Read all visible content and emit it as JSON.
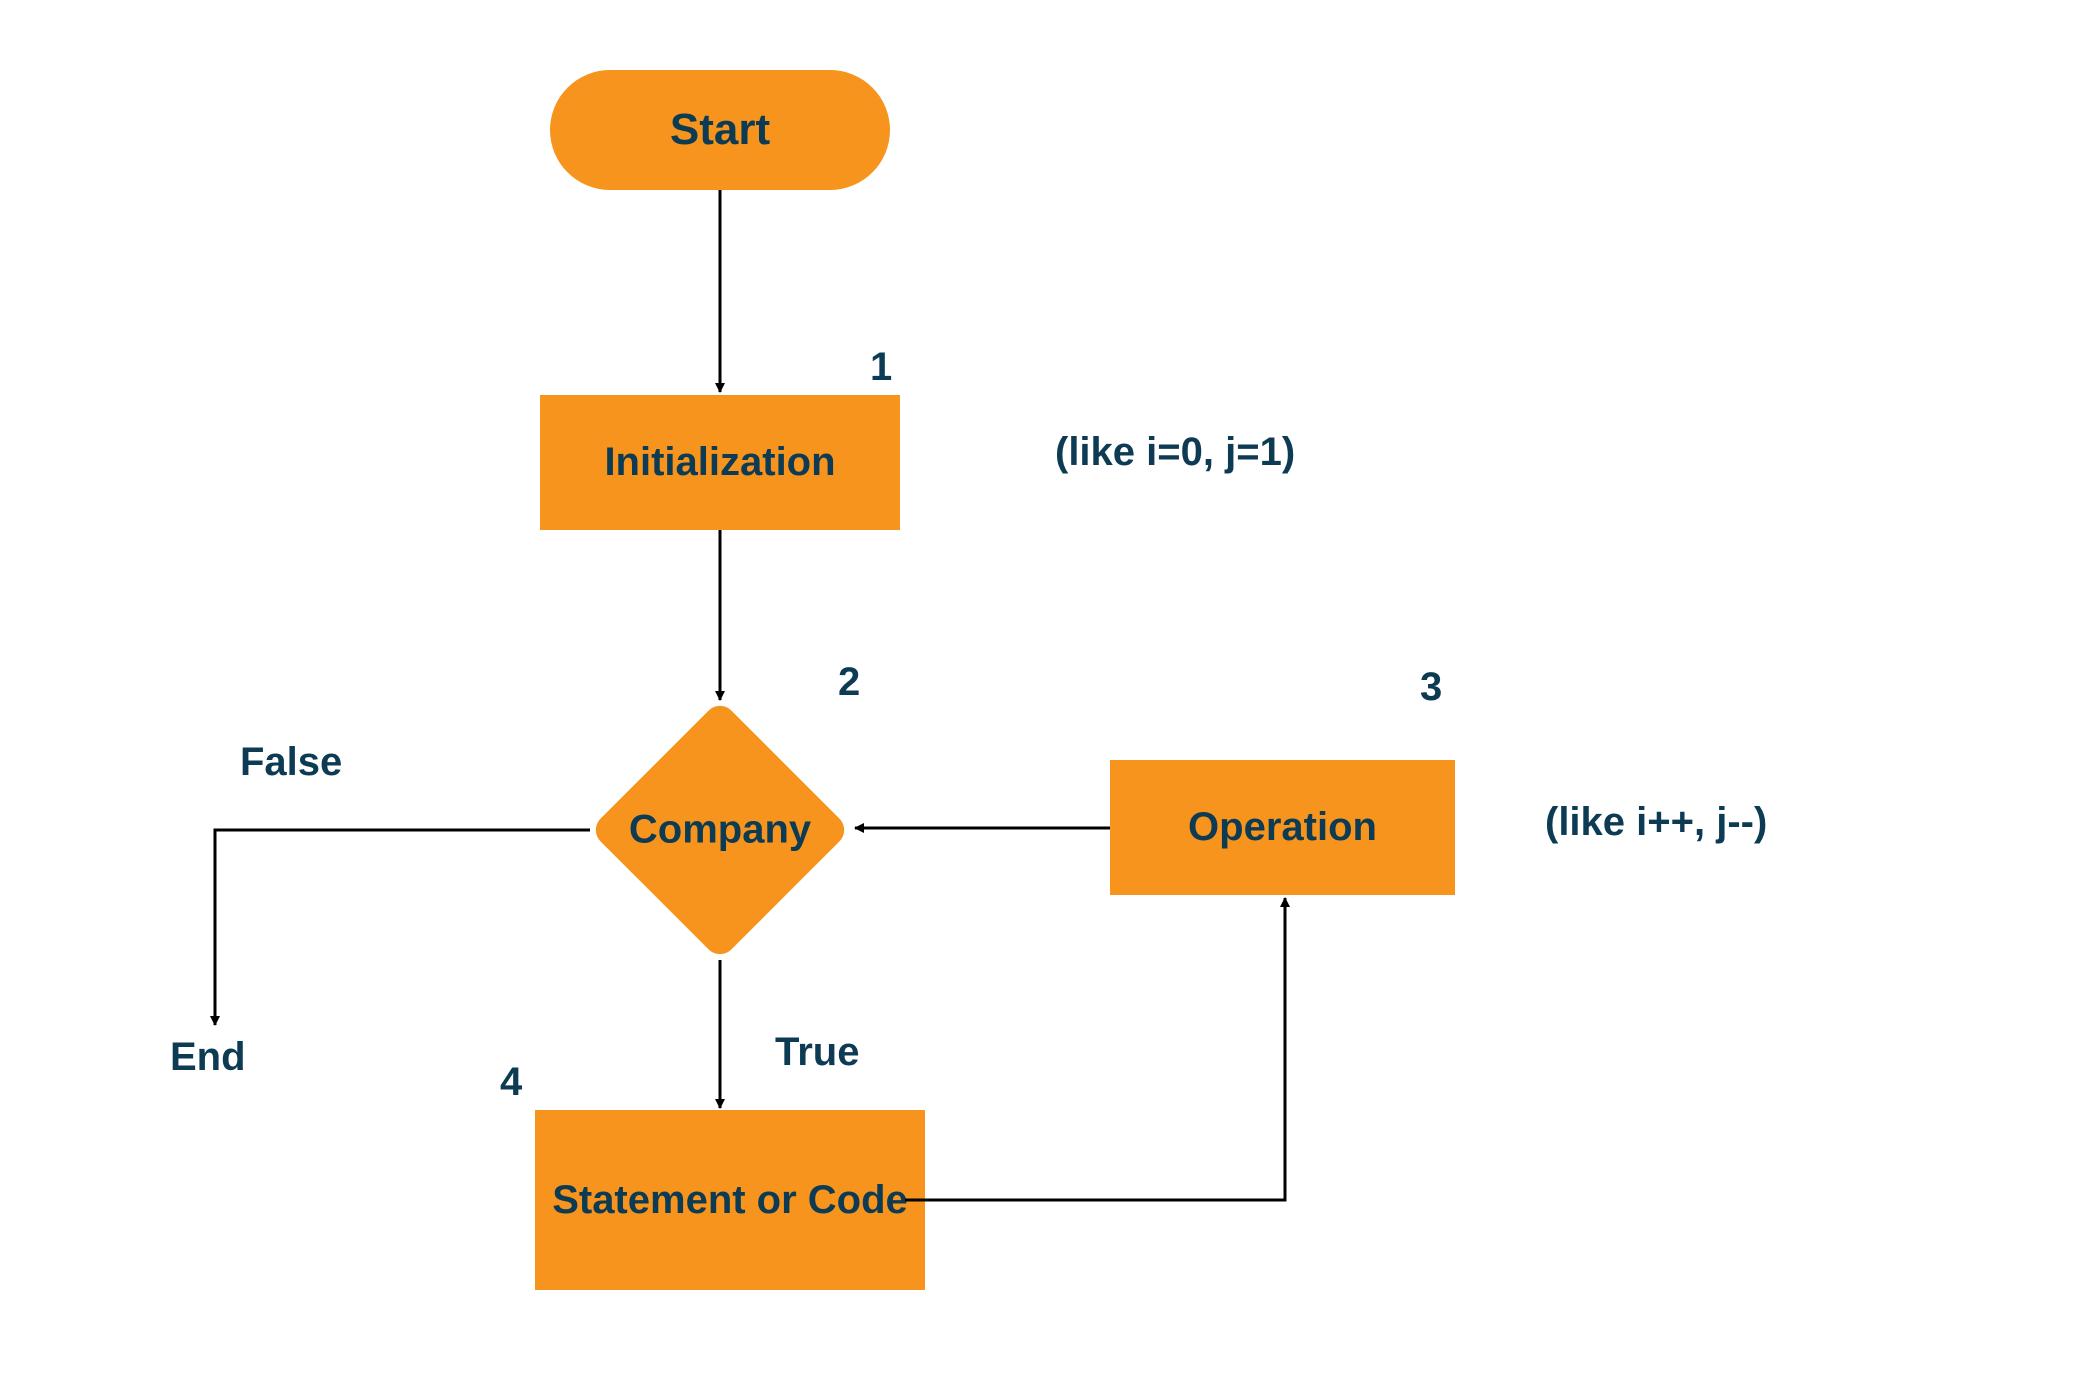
{
  "nodes": {
    "start": {
      "label": "Start"
    },
    "init": {
      "label": "Initialization",
      "num": "1",
      "annot": "(like i=0, j=1)"
    },
    "decision": {
      "label": "Company",
      "num": "2"
    },
    "operation": {
      "label": "Operation",
      "num": "3",
      "annot": "(like i++, j--)"
    },
    "statement": {
      "label": "Statement or Code",
      "num": "4"
    }
  },
  "edges": {
    "false_label": "False",
    "true_label": "True",
    "end_label": "End"
  },
  "colors": {
    "shape": "#f7941d",
    "text": "#0d3b53",
    "arrow": "#000000"
  }
}
